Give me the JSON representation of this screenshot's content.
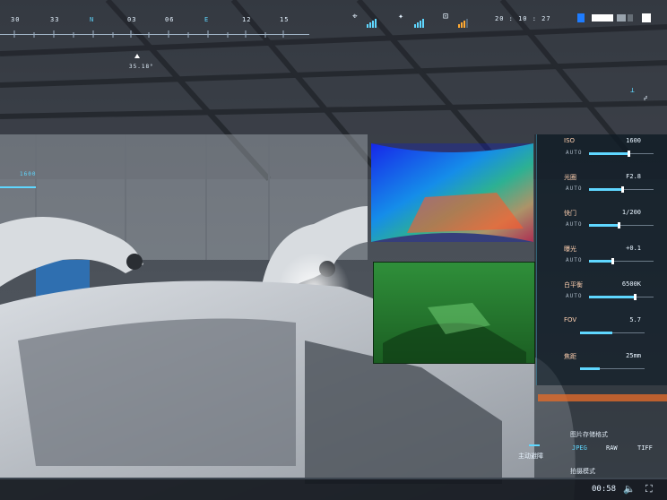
{
  "compass": {
    "headings": [
      "30",
      "33",
      "N",
      "03",
      "06",
      "E",
      "12",
      "15"
    ],
    "heading_value": "35.18°"
  },
  "status": {
    "clock": "20 : 10 : 27",
    "icons": [
      "satellite-dish-icon",
      "satellite-icon",
      "drone-remote-icon"
    ]
  },
  "left_readout": {
    "value": "1600"
  },
  "camera_panel": {
    "iso": {
      "label": "ISO",
      "value": "1600",
      "mode": "AUTO",
      "level": 0.6
    },
    "aperture": {
      "label": "光圈",
      "value": "F2.8",
      "mode": "AUTO",
      "level": 0.5
    },
    "shutter": {
      "label": "快门",
      "value": "1/200",
      "mode": "AUTO",
      "level": 0.45
    },
    "exposure": {
      "label": "曝光",
      "value": "+0.1",
      "mode": "AUTO",
      "level": 0.35
    },
    "white_balance": {
      "label": "白平衡",
      "value": "6500K",
      "mode": "AUTO",
      "level": 0.7
    },
    "fov": {
      "label": "FOV",
      "value": "5.7",
      "level": 0.5
    },
    "focal": {
      "label": "焦距",
      "value": "25mm",
      "level": 0.3
    }
  },
  "storage": {
    "title": "图片存储格式",
    "formats": [
      "JPEG",
      "RAW",
      "TIFF"
    ],
    "selected": "JPEG",
    "sub_title": "拍摄模式"
  },
  "left_bottom": {
    "label": "主动避障"
  },
  "player": {
    "time": "00:58"
  },
  "colors": {
    "accent": "#5fd7ff",
    "panel": "#0c1a24",
    "highlight": "#ff9a6a"
  }
}
